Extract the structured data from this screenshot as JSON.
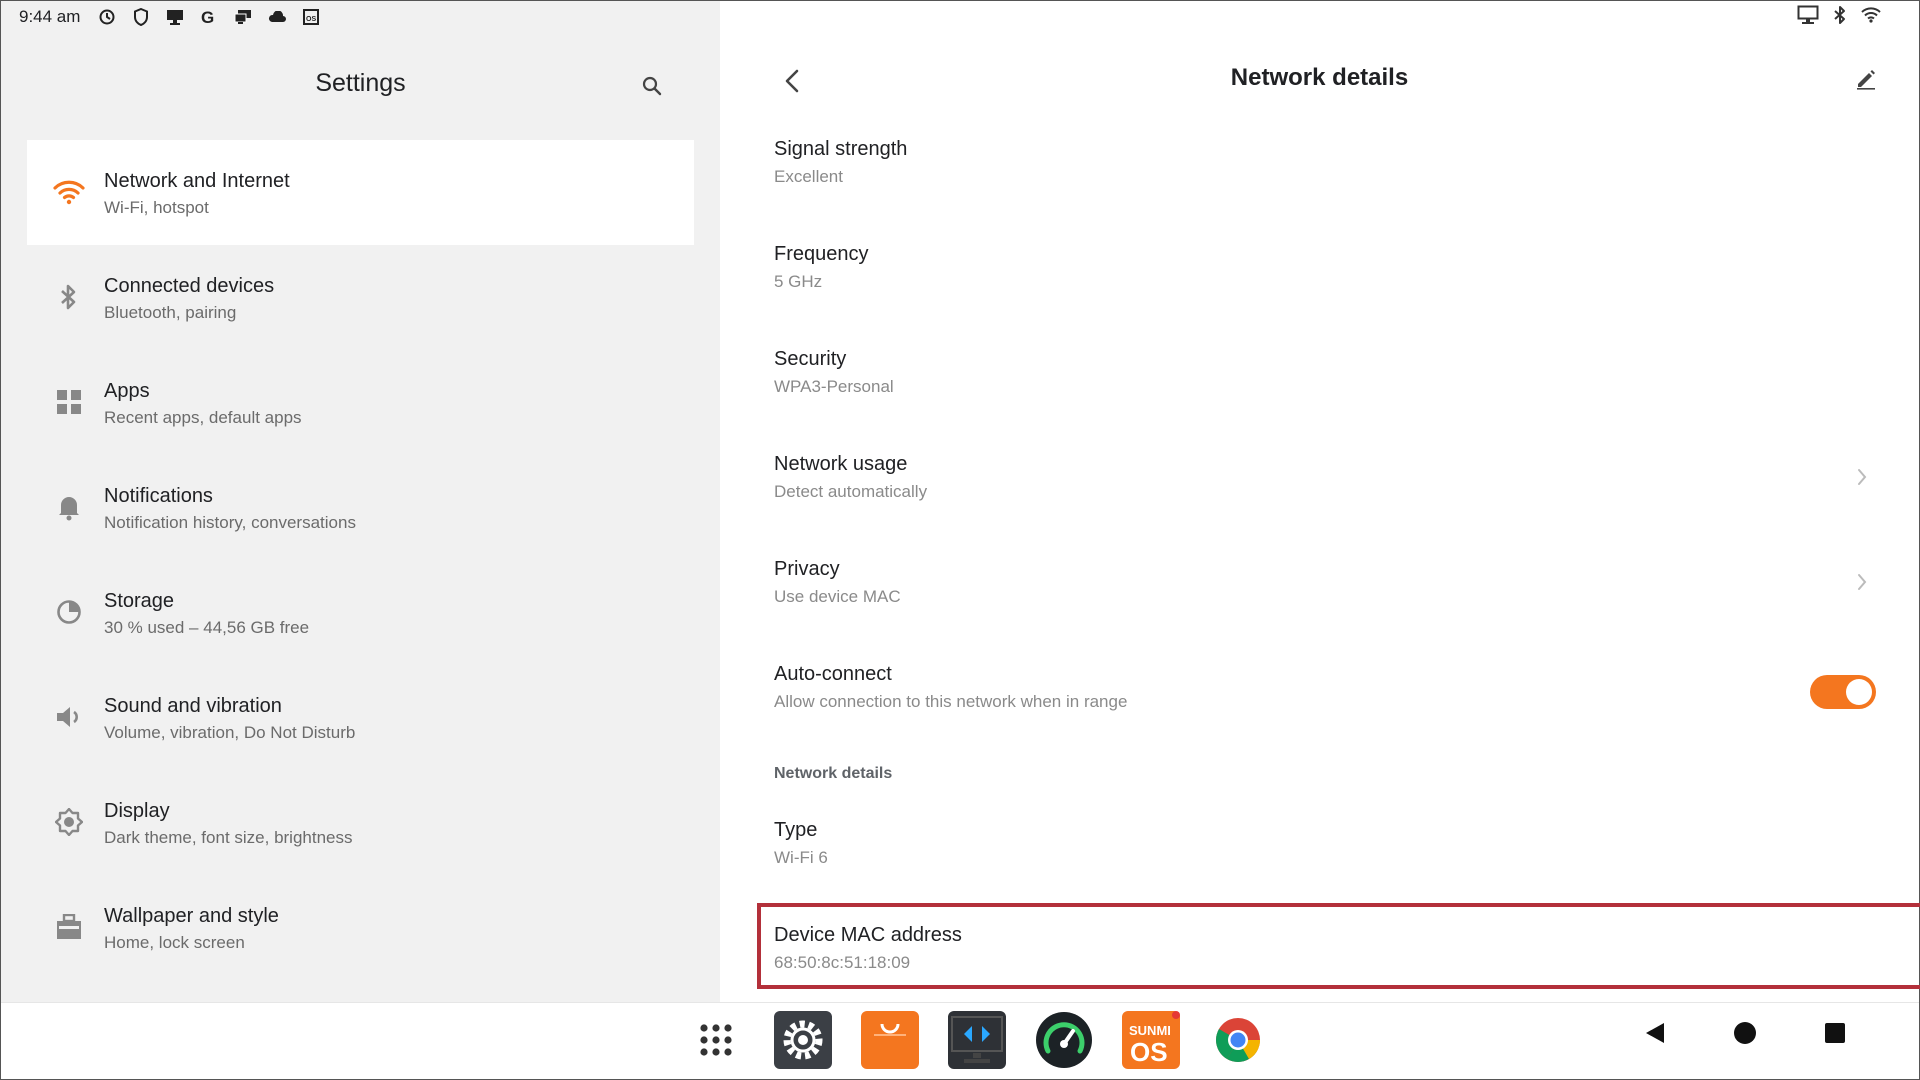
{
  "status_bar": {
    "time": "9:44 am"
  },
  "left": {
    "title": "Settings",
    "menu": [
      {
        "icon": "wifi-icon",
        "title": "Network and Internet",
        "subtitle": "Wi-Fi, hotspot",
        "active": true
      },
      {
        "icon": "bluetooth-icon",
        "title": "Connected devices",
        "subtitle": "Bluetooth, pairing"
      },
      {
        "icon": "apps-grid-icon",
        "title": "Apps",
        "subtitle": "Recent apps, default apps"
      },
      {
        "icon": "bell-icon",
        "title": "Notifications",
        "subtitle": "Notification history, conversations"
      },
      {
        "icon": "storage-pie-icon",
        "title": "Storage",
        "subtitle": "30 % used – 44,56 GB free"
      },
      {
        "icon": "speaker-icon",
        "title": "Sound and vibration",
        "subtitle": "Volume, vibration, Do Not Disturb"
      },
      {
        "icon": "display-brightness-icon",
        "title": "Display",
        "subtitle": "Dark theme, font size, brightness"
      },
      {
        "icon": "wallpaper-icon",
        "title": "Wallpaper and style",
        "subtitle": "Home, lock screen"
      }
    ]
  },
  "right": {
    "title": "Network details",
    "rows": [
      {
        "title": "Signal strength",
        "subtitle": "Excellent"
      },
      {
        "title": "Frequency",
        "subtitle": "5 GHz"
      },
      {
        "title": "Security",
        "subtitle": "WPA3-Personal"
      },
      {
        "title": "Network usage",
        "subtitle": "Detect automatically"
      },
      {
        "title": "Privacy",
        "subtitle": "Use device MAC"
      },
      {
        "title": "Auto-connect",
        "subtitle": "Allow connection to this network when in range",
        "toggle_on": true
      }
    ],
    "section_header": "Network details",
    "details": [
      {
        "title": "Type",
        "subtitle": "Wi-Fi 6"
      },
      {
        "title": "Device MAC address",
        "subtitle": "68:50:8c:51:18:09"
      }
    ]
  },
  "taskbar": {
    "apps": [
      "app-drawer-icon",
      "settings-app-icon",
      "store-app-icon",
      "remote-desktop-app-icon",
      "speedometer-app-icon",
      "sunmi-os-app-icon",
      "chrome-app-icon"
    ],
    "sunmi_label": "SUNMI OS"
  },
  "colors": {
    "accent": "#f4761f",
    "highlight": "#b3303a",
    "left_bg": "#f1f1f1"
  }
}
